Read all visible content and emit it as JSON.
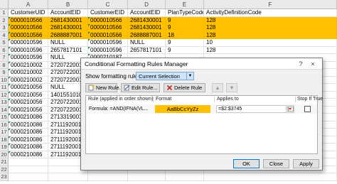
{
  "sheet": {
    "columns": [
      "A",
      "B",
      "C",
      "D",
      "E",
      "F"
    ],
    "row_numbers": [
      "1",
      "2",
      "3",
      "4",
      "5",
      "6",
      "7",
      "8",
      "9",
      "10",
      "11",
      "12",
      "13",
      "14",
      "15",
      "16",
      "17",
      "18",
      "19",
      "20",
      "21",
      "22",
      "23"
    ],
    "rows": [
      [
        "CustomerUID",
        "AccountEID",
        "CustomerEID",
        "AccountEID",
        "PlanTypeCode",
        "ActivityDefinitionCode"
      ],
      [
        "0000010566",
        "2681430001",
        "0000010566",
        "2681430001",
        "9",
        "128"
      ],
      [
        "0000010566",
        "2681430001",
        "0000010566",
        "2681430001",
        "9",
        "128"
      ],
      [
        "0000010566",
        "2688887001",
        "0000010566",
        "2688887001",
        "18",
        "128"
      ],
      [
        "0000010596",
        "NULL",
        "0000010596",
        "NULL",
        "9",
        "10"
      ],
      [
        "0000010596",
        "2657817101",
        "0000010596",
        "2657817101",
        "9",
        "128"
      ],
      [
        "0000010596",
        "NULL",
        "0000210187",
        "",
        "",
        ""
      ],
      [
        "0000210002",
        "2720722001",
        "0000210187",
        "",
        "",
        ""
      ],
      [
        "0000210002",
        "2720722001",
        "",
        "",
        "",
        ""
      ],
      [
        "0000210002",
        "2720722001",
        "",
        "",
        "",
        ""
      ],
      [
        "0000210056",
        "NULL",
        "",
        "",
        "",
        ""
      ],
      [
        "0000210056",
        "1401551010",
        "",
        "",
        "",
        ""
      ],
      [
        "0000210056",
        "2720722001",
        "",
        "",
        "",
        ""
      ],
      [
        "0000210056",
        "2720722001",
        "",
        "",
        "",
        ""
      ],
      [
        "0000210086",
        "2713319001",
        "",
        "",
        "",
        ""
      ],
      [
        "0000210086",
        "2711192001",
        "",
        "",
        "",
        ""
      ],
      [
        "0000210086",
        "2711192001",
        "",
        "",
        "",
        ""
      ],
      [
        "0000210086",
        "2711192001",
        "",
        "",
        "",
        ""
      ],
      [
        "0000210086",
        "2711192001",
        "",
        "",
        "",
        ""
      ],
      [
        "0000210086",
        "2711192001",
        "",
        "",
        "",
        ""
      ],
      [
        "",
        "",
        "",
        "",
        "",
        ""
      ],
      [
        "",
        "",
        "",
        "",
        "",
        ""
      ],
      [
        "",
        "",
        "",
        "",
        "",
        ""
      ]
    ],
    "highlight_color": "#ffc000"
  },
  "dialog": {
    "title": "Conditional Formatting Rules Manager",
    "help_glyph": "?",
    "close_glyph": "×",
    "show_label": "Show formatting rules for:",
    "show_value": "Current Selection",
    "new_rule": "New Rule...",
    "edit_rule": "Edit Rule...",
    "delete_rule": "Delete Rule",
    "up_glyph": "▲",
    "down_glyph": "▼",
    "headers": {
      "rule": "Rule (applied in order shown)",
      "format": "Format",
      "applies_to": "Applies to",
      "stop_if_true": "Stop If True"
    },
    "rule_text": "Formula: =AND(IFNA(VL...",
    "format_preview": "AaBbCcYyZz",
    "applies_to_value": "=$2:$3745",
    "ok": "OK",
    "close": "Close",
    "apply": "Apply",
    "accent_color": "#0078d7"
  },
  "icons": {
    "new_rule": "new-rule-icon",
    "edit_rule": "edit-rule-icon",
    "delete_rule": "delete-icon",
    "range": "range-select-icon"
  }
}
